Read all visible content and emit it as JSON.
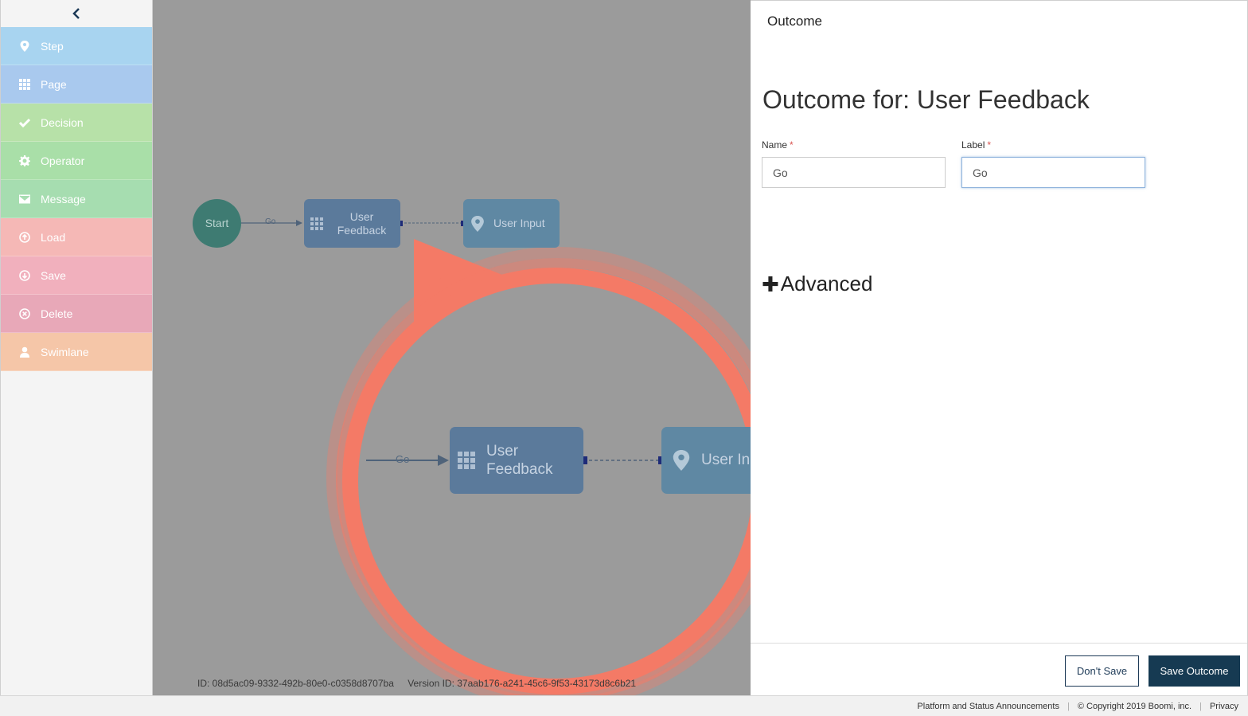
{
  "sidebar": {
    "collapse_icon": "chevron-left-icon",
    "items": [
      {
        "label": "Step",
        "icon": "map-pin-icon",
        "color": "#a8d4f0"
      },
      {
        "label": "Page",
        "icon": "grid-icon",
        "color": "#a9c9ee"
      },
      {
        "label": "Decision",
        "icon": "check-icon",
        "color": "#b7e1a8"
      },
      {
        "label": "Operator",
        "icon": "gear-icon",
        "color": "#a9dfa8"
      },
      {
        "label": "Message",
        "icon": "envelope-icon",
        "color": "#a6ddb0"
      },
      {
        "label": "Load",
        "icon": "upload-circle-icon",
        "color": "#f5b8b6"
      },
      {
        "label": "Save",
        "icon": "download-circle-icon",
        "color": "#f1b0bd"
      },
      {
        "label": "Delete",
        "icon": "close-circle-icon",
        "color": "#e8a8b8"
      },
      {
        "label": "Swimlane",
        "icon": "user-icon",
        "color": "#f5c6a8"
      }
    ]
  },
  "canvas": {
    "nodes": {
      "start": "Start",
      "feedback": "User Feedback",
      "input": "User Input"
    },
    "outcome_label": "Go",
    "zoom": {
      "feedback": "User Feedback",
      "input": "User In",
      "outcome_label": "Go"
    },
    "id_text": "ID: 08d5ac09-9332-492b-80e0-c0358d8707ba",
    "version_text": "Version ID: 37aab176-a241-45c6-9f53-43173d8c6b21"
  },
  "panel": {
    "header": "Outcome",
    "title": "Outcome for: User Feedback",
    "name_label": "Name",
    "name_value": "Go",
    "label_label": "Label",
    "label_value": "Go",
    "required_mark": "*",
    "advanced_label": "Advanced",
    "dont_save_label": "Don't Save",
    "save_label": "Save Outcome"
  },
  "footer": {
    "announcements": "Platform and Status Announcements",
    "copyright": "© Copyright 2019 Boomi, inc.",
    "privacy": "Privacy"
  },
  "colors": {
    "accent_dark": "#163a52",
    "canvas_bg": "#9b9b9b",
    "highlight": "#f26b5b"
  }
}
